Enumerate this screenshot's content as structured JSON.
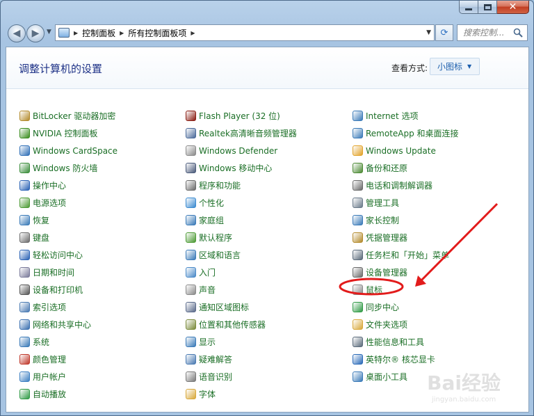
{
  "window": {
    "address": {
      "crumbs": [
        "控制面板",
        "所有控制面板项"
      ]
    },
    "search": {
      "placeholder": "搜索控制..."
    }
  },
  "header": {
    "title": "调整计算机的设置",
    "view_label": "查看方式:",
    "view_value": "小图标"
  },
  "columns": [
    [
      {
        "label": "BitLocker 驱动器加密",
        "icon": "bitlocker-icon",
        "color": "#b38a2b"
      },
      {
        "label": "NVIDIA 控制面板",
        "icon": "nvidia-icon",
        "color": "#3a8d1e"
      },
      {
        "label": "Windows CardSpace",
        "icon": "cardspace-icon",
        "color": "#2f6fb7"
      },
      {
        "label": "Windows 防火墙",
        "icon": "firewall-icon",
        "color": "#3a8d3a"
      },
      {
        "label": "操作中心",
        "icon": "flag-icon",
        "color": "#2a62b5"
      },
      {
        "label": "电源选项",
        "icon": "power-icon",
        "color": "#4c9a34"
      },
      {
        "label": "恢复",
        "icon": "recovery-icon",
        "color": "#3a7ab8"
      },
      {
        "label": "键盘",
        "icon": "keyboard-icon",
        "color": "#6c6c6c"
      },
      {
        "label": "轻松访问中心",
        "icon": "ease-of-access-icon",
        "color": "#2a62b5"
      },
      {
        "label": "日期和时间",
        "icon": "calendar-clock-icon",
        "color": "#7a7a9a"
      },
      {
        "label": "设备和打印机",
        "icon": "printer-icon",
        "color": "#555555"
      },
      {
        "label": "索引选项",
        "icon": "index-icon",
        "color": "#4a7ab2"
      },
      {
        "label": "网络和共享中心",
        "icon": "network-icon",
        "color": "#3a6fb0"
      },
      {
        "label": "系统",
        "icon": "system-icon",
        "color": "#3a7ab8"
      },
      {
        "label": "颜色管理",
        "icon": "color-icon",
        "color": "#c0392b"
      },
      {
        "label": "用户帐户",
        "icon": "user-icon",
        "color": "#3d7fc2"
      },
      {
        "label": "自动播放",
        "icon": "autoplay-icon",
        "color": "#2f9a45"
      }
    ],
    [
      {
        "label": "Flash Player (32 位)",
        "icon": "flash-icon",
        "color": "#8a1c12"
      },
      {
        "label": "Realtek高清晰音频管理器",
        "icon": "audio-manager-icon",
        "color": "#4a6a9a"
      },
      {
        "label": "Windows Defender",
        "icon": "defender-icon",
        "color": "#8a8a8a"
      },
      {
        "label": "Windows 移动中心",
        "icon": "mobility-icon",
        "color": "#4a5a7a"
      },
      {
        "label": "程序和功能",
        "icon": "programs-icon",
        "color": "#6a6a6a"
      },
      {
        "label": "个性化",
        "icon": "personalize-icon",
        "color": "#3a8ad0"
      },
      {
        "label": "家庭组",
        "icon": "homegroup-icon",
        "color": "#3a7ab8"
      },
      {
        "label": "默认程序",
        "icon": "default-programs-icon",
        "color": "#4c9a34"
      },
      {
        "label": "区域和语言",
        "icon": "globe-icon",
        "color": "#3a7ab8"
      },
      {
        "label": "入门",
        "icon": "getting-started-icon",
        "color": "#4a8ac8"
      },
      {
        "label": "声音",
        "icon": "speaker-icon",
        "color": "#8a8a8a"
      },
      {
        "label": "通知区域图标",
        "icon": "notification-icon",
        "color": "#5a6a8a"
      },
      {
        "label": "位置和其他传感器",
        "icon": "sensor-icon",
        "color": "#7a8a3a"
      },
      {
        "label": "显示",
        "icon": "display-icon",
        "color": "#3a7ab8"
      },
      {
        "label": "疑难解答",
        "icon": "troubleshoot-icon",
        "color": "#4a7ab2"
      },
      {
        "label": "语音识别",
        "icon": "microphone-icon",
        "color": "#7a7a7a"
      },
      {
        "label": "字体",
        "icon": "font-folder-icon",
        "color": "#d8a83a"
      }
    ],
    [
      {
        "label": "Internet 选项",
        "icon": "internet-options-icon",
        "color": "#3a7ab8"
      },
      {
        "label": "RemoteApp 和桌面连接",
        "icon": "remoteapp-icon",
        "color": "#3a7ab8"
      },
      {
        "label": "Windows Update",
        "icon": "windows-update-icon",
        "color": "#e2a32a"
      },
      {
        "label": "备份和还原",
        "icon": "backup-icon",
        "color": "#4c8a34"
      },
      {
        "label": "电话和调制解调器",
        "icon": "phone-modem-icon",
        "color": "#6a6a6a"
      },
      {
        "label": "管理工具",
        "icon": "admin-tools-icon",
        "color": "#6a7a8a"
      },
      {
        "label": "家长控制",
        "icon": "parental-controls-icon",
        "color": "#3a7ab8"
      },
      {
        "label": "凭据管理器",
        "icon": "credential-icon",
        "color": "#b38a2b"
      },
      {
        "label": "任务栏和「开始」菜单",
        "icon": "taskbar-icon",
        "color": "#5a6a7a"
      },
      {
        "label": "设备管理器",
        "icon": "device-manager-icon",
        "color": "#6a6a6a"
      },
      {
        "label": "鼠标",
        "icon": "mouse-icon",
        "color": "#8a8a8a"
      },
      {
        "label": "同步中心",
        "icon": "sync-icon",
        "color": "#2f9a45"
      },
      {
        "label": "文件夹选项",
        "icon": "folder-options-icon",
        "color": "#d8a83a"
      },
      {
        "label": "性能信息和工具",
        "icon": "performance-icon",
        "color": "#5a6a7a"
      },
      {
        "label": "英特尔® 核芯显卡",
        "icon": "intel-graphics-icon",
        "color": "#2a6ab8"
      },
      {
        "label": "桌面小工具",
        "icon": "gadgets-icon",
        "color": "#3a7ab8"
      }
    ]
  ],
  "annotation": {
    "highlight_color": "#e21b1b"
  },
  "watermark": {
    "logo": "Bai经验",
    "url": "jingyan.baidu.com"
  }
}
